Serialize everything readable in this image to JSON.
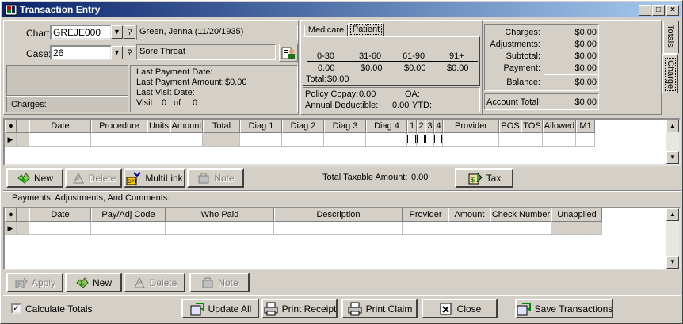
{
  "window": {
    "title": "Transaction Entry",
    "minimize": "_",
    "maximize": "□",
    "close": "×"
  },
  "patient": {
    "chart_label": "Chart:",
    "chart_value": "GREJE000",
    "patient_name": "Green, Jenna  (11/20/1935)",
    "case_label": "Case:",
    "case_value": "26",
    "case_description": "Sore Throat",
    "charges_label": "Charges:",
    "last_payment_date_label": "Last Payment Date:",
    "last_payment_amount_label": "Last Payment Amount:",
    "last_payment_amount": "$0.00",
    "last_visit_date_label": "Last Visit Date:",
    "visit_label": "Visit:",
    "visit_num": "0",
    "visit_of": "of",
    "visit_total": "0"
  },
  "aging": {
    "tabs": [
      "Medicare",
      "Patient"
    ],
    "active_tab": "Patient",
    "headers": [
      "0-30",
      "31-60",
      "61-90",
      "91+"
    ],
    "values": [
      "0.00",
      "$0.00",
      "$0.00",
      "$0.00"
    ],
    "total_label": "Total:",
    "total_value": "$0.00",
    "policy_copay_label": "Policy Copay:",
    "policy_copay_value": "0.00",
    "oa_label": "OA:",
    "annual_deductible_label": "Annual Deductible:",
    "annual_deductible_value": "0.00",
    "ytd_label": "YTD:"
  },
  "totals": {
    "charges_label": "Charges:",
    "charges_value": "$0.00",
    "adjustments_label": "Adjustments:",
    "adjustments_value": "$0.00",
    "subtotal_label": "Subtotal:",
    "subtotal_value": "$0.00",
    "payment_label": "Payment:",
    "payment_value": "$0.00",
    "balance_label": "Balance:",
    "balance_value": "$0.00",
    "account_total_label": "Account Total:",
    "account_total_value": "$0.00"
  },
  "side_tabs": [
    "Totals",
    "Charge"
  ],
  "charges_grid": {
    "columns": [
      "Date",
      "Procedure",
      "Units",
      "Amount",
      "Total",
      "Diag 1",
      "Diag 2",
      "Diag 3",
      "Diag 4",
      "1",
      "2",
      "3",
      "4",
      "Provider",
      "POS",
      "TOS",
      "Allowed",
      "M1"
    ]
  },
  "charges_toolbar": {
    "new_label": "New",
    "delete_label": "Delete",
    "multilink_label": "MultiLink",
    "note_label": "Note",
    "taxable_label": "Total Taxable Amount:",
    "taxable_value": "0.00",
    "tax_label": "Tax"
  },
  "payments_section_title": "Payments, Adjustments, And Comments:",
  "payments_grid": {
    "columns": [
      "Date",
      "Pay/Adj Code",
      "Who Paid",
      "Description",
      "Provider",
      "Amount",
      "Check Number",
      "Unapplied"
    ]
  },
  "payments_toolbar": {
    "apply_label": "Apply",
    "new_label": "New",
    "delete_label": "Delete",
    "note_label": "Note"
  },
  "footer": {
    "calculate_totals_label": "Calculate Totals",
    "calculate_totals_checked": true,
    "update_all_label": "Update All",
    "print_receipt_label": "Print Receipt",
    "print_claim_label": "Print Claim",
    "close_label": "Close",
    "save_label": "Save Transactions"
  }
}
